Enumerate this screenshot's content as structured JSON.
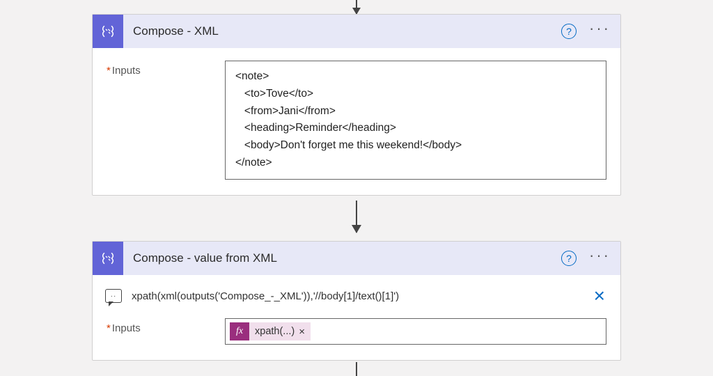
{
  "card1": {
    "title": "Compose - XML",
    "inputs_label": "Inputs",
    "required_marker": "*",
    "xml_line1": "<note>",
    "xml_line2": "   <to>Tove</to>",
    "xml_line3": "   <from>Jani</from>",
    "xml_line4": "   <heading>Reminder</heading>",
    "xml_line5": "   <body>Don't forget me this weekend!</body>",
    "xml_line6": "</note>"
  },
  "card2": {
    "title": "Compose - value from XML",
    "expression": "xpath(xml(outputs('Compose_-_XML')),'//body[1]/text()[1]')",
    "inputs_label": "Inputs",
    "required_marker": "*",
    "fx_label": "fx",
    "token_label": "xpath(...)",
    "token_remove": "×"
  },
  "icons": {
    "help": "?",
    "menu": "···",
    "close": "×",
    "bubble_dots": "··"
  }
}
